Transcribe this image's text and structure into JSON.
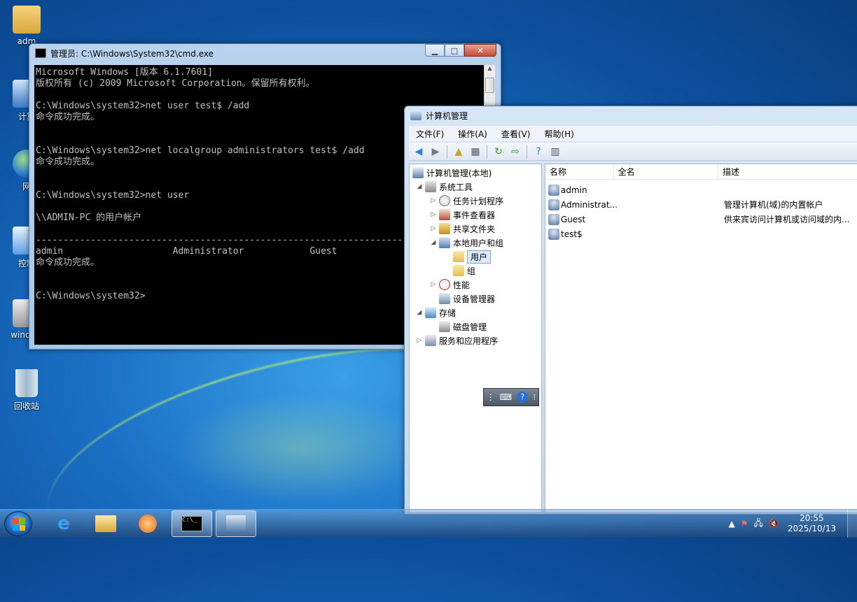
{
  "desktop": {
    "icons": [
      {
        "label": "adm",
        "icon": "user-folder-icon"
      },
      {
        "label": "计算",
        "icon": "computer-icon"
      },
      {
        "label": "网",
        "icon": "network-icon"
      },
      {
        "label": "控制",
        "icon": "control-panel-icon"
      },
      {
        "label": "window",
        "icon": "windows-update-icon"
      },
      {
        "label": "回收站",
        "icon": "recycle-bin-icon"
      }
    ]
  },
  "cmd": {
    "title": "管理员: C:\\Windows\\System32\\cmd.exe",
    "console_text": "Microsoft Windows [版本 6.1.7601]\n版权所有 (c) 2009 Microsoft Corporation。保留所有权利。\n\nC:\\Windows\\system32>net user test$ /add\n命令成功完成。\n\n\nC:\\Windows\\system32>net localgroup administrators test$ /add\n命令成功完成。\n\n\nC:\\Windows\\system32>net user\n\n\\\\ADMIN-PC 的用户帐户\n\n-------------------------------------------------------------------------------\nadmin                    Administrator            Guest\n命令成功完成。\n\n\nC:\\Windows\\system32>"
  },
  "mmc": {
    "title": "计算机管理",
    "menu": [
      "文件(F)",
      "操作(A)",
      "查看(V)",
      "帮助(H)"
    ],
    "tree": {
      "root": "计算机管理(本地)",
      "system_tools": "系统工具",
      "task_scheduler": "任务计划程序",
      "event_viewer": "事件查看器",
      "shared_folders": "共享文件夹",
      "local_users_groups": "本地用户和组",
      "users": "用户",
      "groups": "组",
      "performance": "性能",
      "device_manager": "设备管理器",
      "storage": "存储",
      "disk_management": "磁盘管理",
      "services_apps": "服务和应用程序"
    },
    "columns": [
      "名称",
      "全名",
      "描述"
    ],
    "users": [
      {
        "name": "admin",
        "full_name": "",
        "description": ""
      },
      {
        "name": "Administrat...",
        "full_name": "",
        "description": "管理计算机(域)的内置帐户"
      },
      {
        "name": "Guest",
        "full_name": "",
        "description": "供来宾访问计算机或访问域的内..."
      },
      {
        "name": "test$",
        "full_name": "",
        "description": ""
      }
    ]
  },
  "taskbar": {
    "time": "20:55",
    "date": "2025/10/13"
  }
}
